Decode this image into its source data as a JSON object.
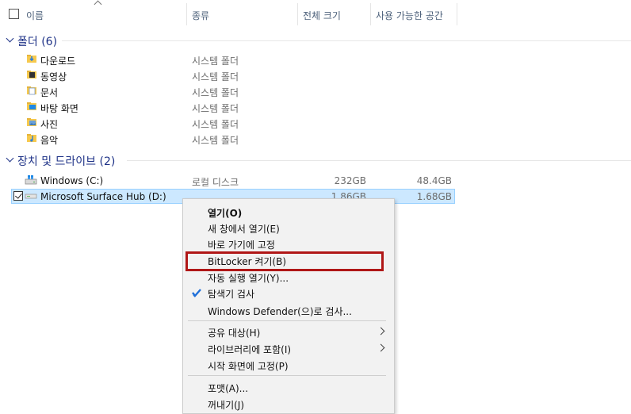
{
  "header": {
    "name_label": "이름",
    "type_label": "종류",
    "total_label": "전체 크기",
    "free_label": "사용 가능한 공간"
  },
  "groups": {
    "folders": {
      "title": "폴더 (6)"
    },
    "devices": {
      "title": "장치 및 드라이브 (2)"
    }
  },
  "folders": [
    {
      "name": "다운로드",
      "type": "시스템 폴더",
      "icon": "downloads-folder-icon",
      "color": "#2f7fd8"
    },
    {
      "name": "동영상",
      "type": "시스템 폴더",
      "icon": "videos-folder-icon",
      "color": "#333333"
    },
    {
      "name": "문서",
      "type": "시스템 폴더",
      "icon": "documents-folder-icon",
      "color": "#7b9ac4"
    },
    {
      "name": "바탕 화면",
      "type": "시스템 폴더",
      "icon": "desktop-folder-icon",
      "color": "#1e88e5"
    },
    {
      "name": "사진",
      "type": "시스템 폴더",
      "icon": "pictures-folder-icon",
      "color": "#6aa0d8"
    },
    {
      "name": "음악",
      "type": "시스템 폴더",
      "icon": "music-folder-icon",
      "color": "#2f7fd8"
    }
  ],
  "drives": [
    {
      "name": "Windows (C:)",
      "type": "로컬 디스크",
      "total": "232GB",
      "free": "48.4GB",
      "icon": "windows-drive-icon"
    },
    {
      "name": "Microsoft Surface Hub (D:)",
      "type": "",
      "total": "1.86GB",
      "free": "1.68GB",
      "icon": "usb-drive-icon"
    }
  ],
  "context_menu": {
    "open": "열기(O)",
    "open_new_window": "새 창에서 열기(E)",
    "pin_quick_access": "바로 가기에 고정",
    "bitlocker": "BitLocker 켜기(B)",
    "autoplay": "자동 실행 열기(Y)...",
    "explorer_scan": "탐색기 검사",
    "defender_scan": "Windows Defender(으)로 검사...",
    "share_with": "공유 대상(H)",
    "include_library": "라이브러리에 포함(I)",
    "pin_start": "시작 화면에 고정(P)",
    "format": "포맷(A)...",
    "eject": "꺼내기(J)"
  },
  "colors": {
    "accent": "#1e3287",
    "selection": "#cce8ff",
    "highlight_box": "#b01717"
  }
}
